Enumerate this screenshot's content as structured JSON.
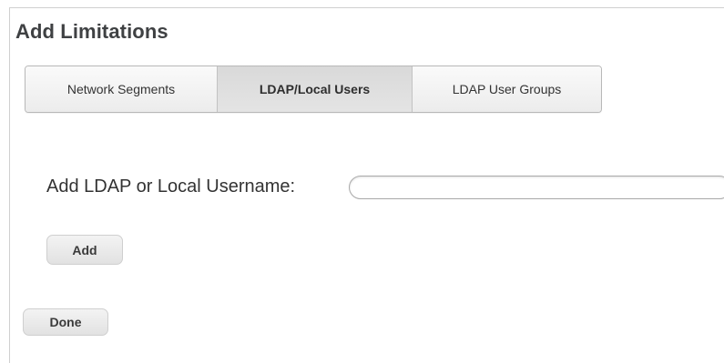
{
  "dialog": {
    "title": "Add Limitations"
  },
  "tabs": [
    {
      "label": "Network Segments",
      "selected": false
    },
    {
      "label": "LDAP/Local Users",
      "selected": true
    },
    {
      "label": "LDAP User Groups",
      "selected": false
    }
  ],
  "form": {
    "username_label": "Add LDAP or Local Username:",
    "username_value": "",
    "add_label": "Add"
  },
  "footer": {
    "done_label": "Done"
  }
}
